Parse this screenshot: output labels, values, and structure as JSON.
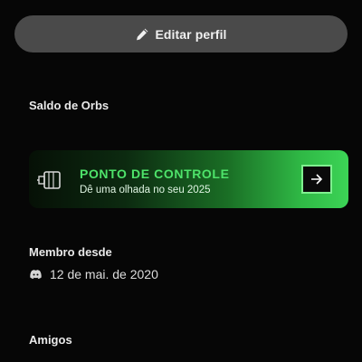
{
  "profile": {
    "edit_button_label": "Editar perfil"
  },
  "orbs": {
    "section_title": "Saldo de Orbs"
  },
  "checkpoint_banner": {
    "title": "PONTO DE CONTROLE",
    "subtitle": "Dê uma olhada no seu 2025",
    "accent_color": "#4ee36a"
  },
  "member_since": {
    "section_title": "Membro desde",
    "date": "12 de mai. de 2020",
    "icon": "discord-icon"
  },
  "friends": {
    "section_title": "Amigos"
  }
}
